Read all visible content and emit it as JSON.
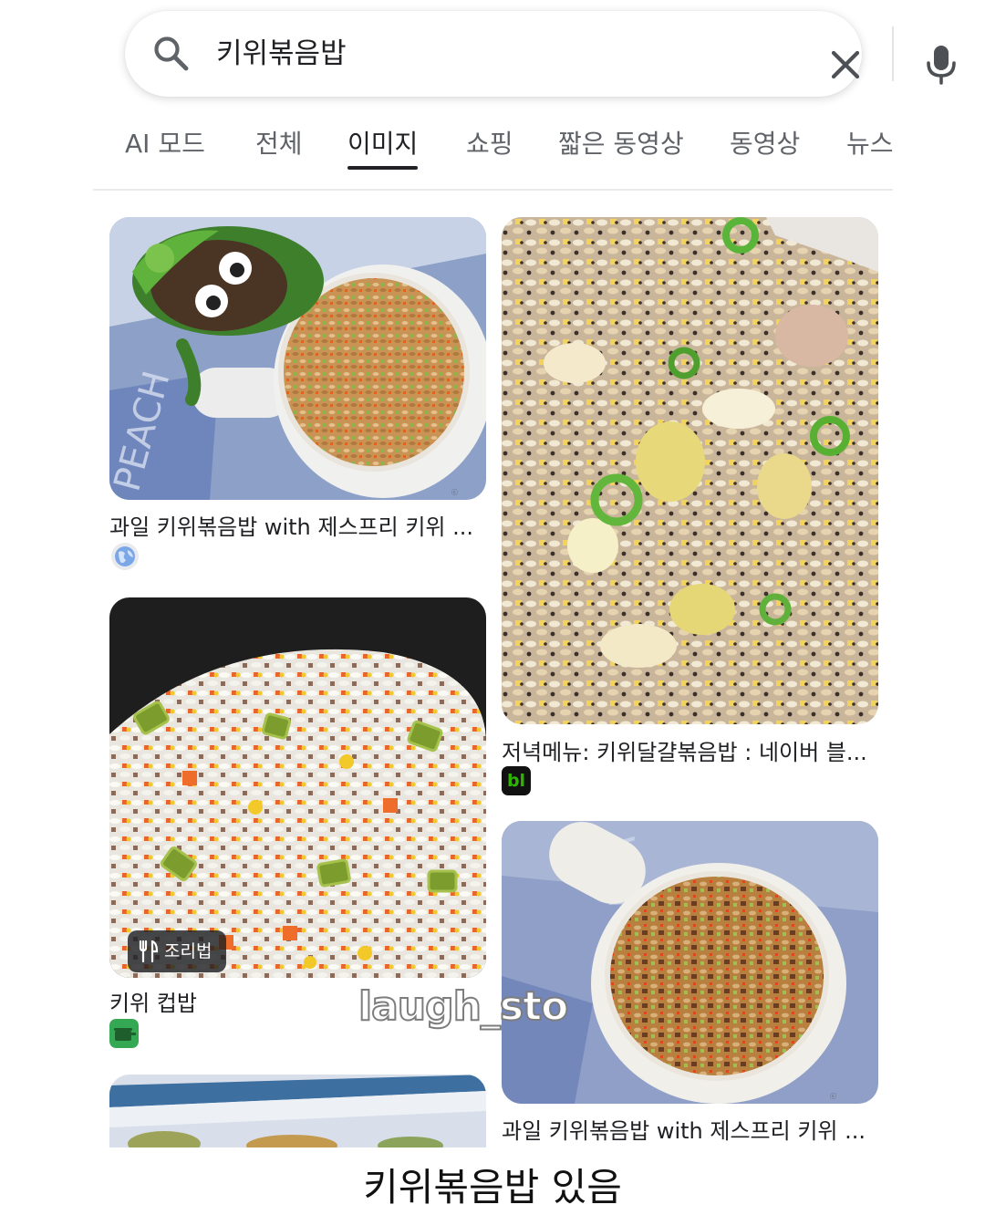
{
  "search": {
    "query": "키위볶음밥"
  },
  "tabs": [
    {
      "label": "AI 모드",
      "active": false
    },
    {
      "label": "전체",
      "active": false
    },
    {
      "label": "이미지",
      "active": true
    },
    {
      "label": "쇼핑",
      "active": false
    },
    {
      "label": "짧은 동영상",
      "active": false
    },
    {
      "label": "동영상",
      "active": false
    },
    {
      "label": "뉴스",
      "active": false
    }
  ],
  "results": [
    {
      "title": "과일 키위볶음밥 with 제스프리 키위 ...",
      "source_icon": "globe-icon"
    },
    {
      "title": "저녁메뉴: 키위달걀볶음밥 : 네이버 블...",
      "source_icon": "naver-blog-icon",
      "source_icon_text": "bl"
    },
    {
      "title": "키위 컵밥",
      "source_icon": "cooking-pot-icon",
      "badge": "조리법"
    },
    {
      "title": "과일 키위볶음밥 with 제스프리 키위 ..."
    }
  ],
  "watermark": "laugh_sto",
  "overlay_caption": "키위볶음밥 있음",
  "colors": {
    "text": "#202124",
    "muted": "#5f6368",
    "divider": "#e8eaed",
    "naver_green": "#2db400",
    "recipe_green": "#34a853"
  }
}
